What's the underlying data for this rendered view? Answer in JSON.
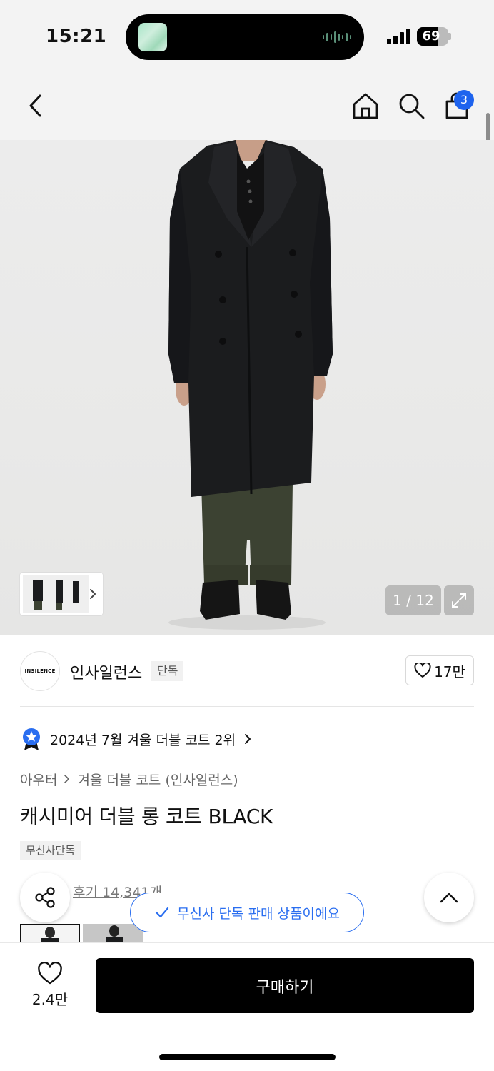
{
  "status_bar": {
    "time": "15:21",
    "battery": "69",
    "battery_level": 0.69,
    "signal_bars": 4
  },
  "nav": {
    "cart_count": "3"
  },
  "gallery": {
    "counter": "1 / 12"
  },
  "brand": {
    "logo_text": "INSILENCE",
    "name": "인사일런스",
    "exclusive_badge": "단독",
    "like_count": "17만"
  },
  "ranking": {
    "text": "2024년 7월 겨울 더블 코트 2위"
  },
  "breadcrumb": {
    "category": "아우터",
    "subcategory": "겨울 더블 코트 (인사일런스)"
  },
  "product": {
    "title": "캐시미어 더블 롱 코트 BLACK",
    "tag": "무신사단독"
  },
  "reviews": {
    "link_text": "후기 14,341개"
  },
  "toast": {
    "text": "무신사 단독 판매 상품이에요"
  },
  "bottom_bar": {
    "like_count": "2.4만",
    "buy_label": "구매하기"
  },
  "colors": {
    "accent": "#2a6ef0",
    "badge": "#1e63ee",
    "buy_button": "#000000"
  }
}
